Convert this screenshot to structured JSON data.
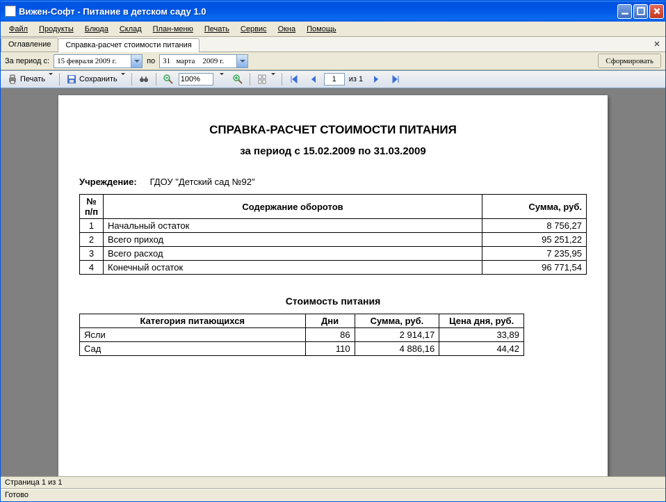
{
  "window": {
    "title": "Вижен-Софт - Питание в детском саду 1.0"
  },
  "menubar": {
    "items": [
      "Файл",
      "Продукты",
      "Блюда",
      "Склад",
      "План-меню",
      "Печать",
      "Сервис",
      "Окна",
      "Помощь"
    ]
  },
  "tabs": {
    "items": [
      "Оглавление",
      "Справка-расчет стоимости питания"
    ],
    "active": 1
  },
  "params": {
    "period_label": "За период с:",
    "date_from": "15 февраля 2009 г.",
    "to_label": "по",
    "date_to": "31   марта    2009 г.",
    "form_button": "Сформировать"
  },
  "toolbar": {
    "print": "Печать",
    "save": "Сохранить",
    "zoom": "100%",
    "page_current": "1",
    "page_of": "из 1"
  },
  "report": {
    "title": "СПРАВКА-РАСЧЕТ СТОИМОСТИ ПИТАНИЯ",
    "subtitle": "за период с 15.02.2009 по 31.03.2009",
    "institution_label": "Учреждение:",
    "institution": "ГДОУ \"Детский сад №92\"",
    "table1": {
      "headers": {
        "num": "№ п/п",
        "desc": "Содержание оборотов",
        "sum": "Сумма, руб."
      },
      "rows": [
        {
          "n": "1",
          "desc": "Начальный остаток",
          "sum": "8 756,27"
        },
        {
          "n": "2",
          "desc": "Всего приход",
          "sum": "95 251,22"
        },
        {
          "n": "3",
          "desc": "Всего расход",
          "sum": "7 235,95"
        },
        {
          "n": "4",
          "desc": "Конечный остаток",
          "sum": "96 771,54"
        }
      ]
    },
    "table2_title": "Стоимость питания",
    "table2": {
      "headers": {
        "cat": "Категория питающихся",
        "days": "Дни",
        "sum": "Сумма, руб.",
        "price": "Цена дня, руб."
      },
      "rows": [
        {
          "cat": "Ясли",
          "days": "86",
          "sum": "2 914,17",
          "price": "33,89"
        },
        {
          "cat": "Сад",
          "days": "110",
          "sum": "4 886,16",
          "price": "44,42"
        }
      ]
    }
  },
  "status": {
    "page": "Страница 1 из 1",
    "ready": "Готово"
  }
}
